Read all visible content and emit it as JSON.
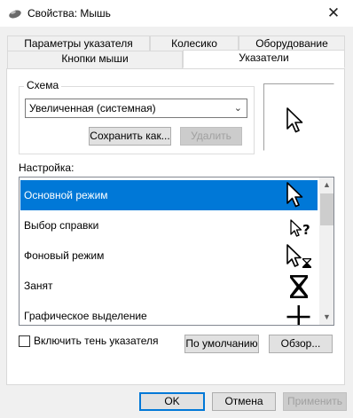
{
  "window": {
    "title": "Свойства: Мышь",
    "close_glyph": "✕"
  },
  "tabs_row1": [
    {
      "label": "Параметры указателя"
    },
    {
      "label": "Колесико"
    },
    {
      "label": "Оборудование"
    }
  ],
  "tabs_row2": [
    {
      "label": "Кнопки мыши"
    },
    {
      "label": "Указатели",
      "active": true
    }
  ],
  "scheme": {
    "group_label": "Схема",
    "selected": "Увеличенная (системная)",
    "save_label": "Сохранить как...",
    "delete_label": "Удалить"
  },
  "settings": {
    "label": "Настройка:",
    "items": [
      {
        "label": "Основной режим",
        "icon": "arrow-cursor-icon",
        "selected": true
      },
      {
        "label": "Выбор справки",
        "icon": "help-select-cursor-icon"
      },
      {
        "label": "Фоновый режим",
        "icon": "working-in-background-cursor-icon"
      },
      {
        "label": "Занят",
        "icon": "busy-hourglass-cursor-icon"
      },
      {
        "label": "Графическое выделение",
        "icon": "precision-crosshair-cursor-icon"
      }
    ]
  },
  "options": {
    "shadow_label": "Включить тень указателя",
    "shadow_checked": false,
    "default_label": "По умолчанию",
    "browse_label": "Обзор..."
  },
  "footer": {
    "ok_label": "OK",
    "cancel_label": "Отмена",
    "apply_label": "Применить"
  },
  "colors": {
    "selection": "#0078d7",
    "window_bg": "#f0f0f0",
    "panel_bg": "#ffffff"
  }
}
